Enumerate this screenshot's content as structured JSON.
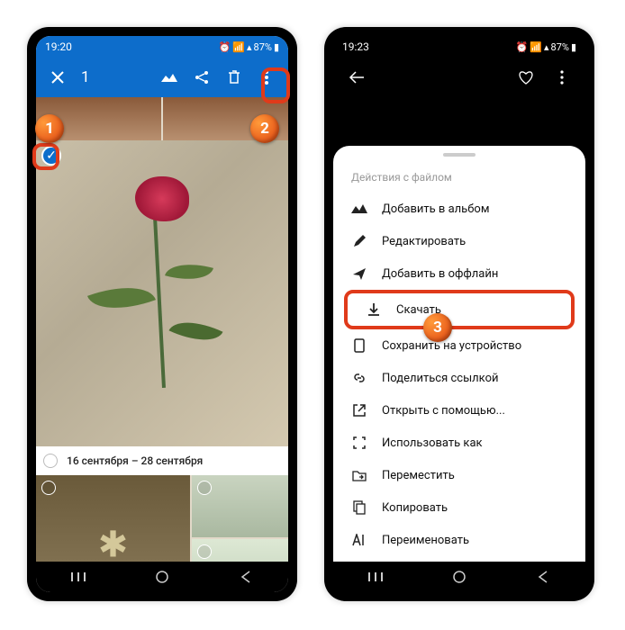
{
  "left": {
    "status": {
      "time": "19:20",
      "battery": "87%"
    },
    "topbar": {
      "count": "1"
    },
    "date_range": "16 сентября – 28 сентября"
  },
  "right": {
    "status": {
      "time": "19:23",
      "battery": "87%"
    },
    "sheet": {
      "title": "Действия с файлом",
      "items": [
        "Добавить в альбом",
        "Редактировать",
        "Добавить в оффлайн",
        "Скачать",
        "Сохранить на устройство",
        "Поделиться ссылкой",
        "Открыть с помощью...",
        "Использовать как",
        "Переместить",
        "Копировать",
        "Переименовать"
      ]
    }
  },
  "badges": {
    "b1": "1",
    "b2": "2",
    "b3": "3"
  }
}
